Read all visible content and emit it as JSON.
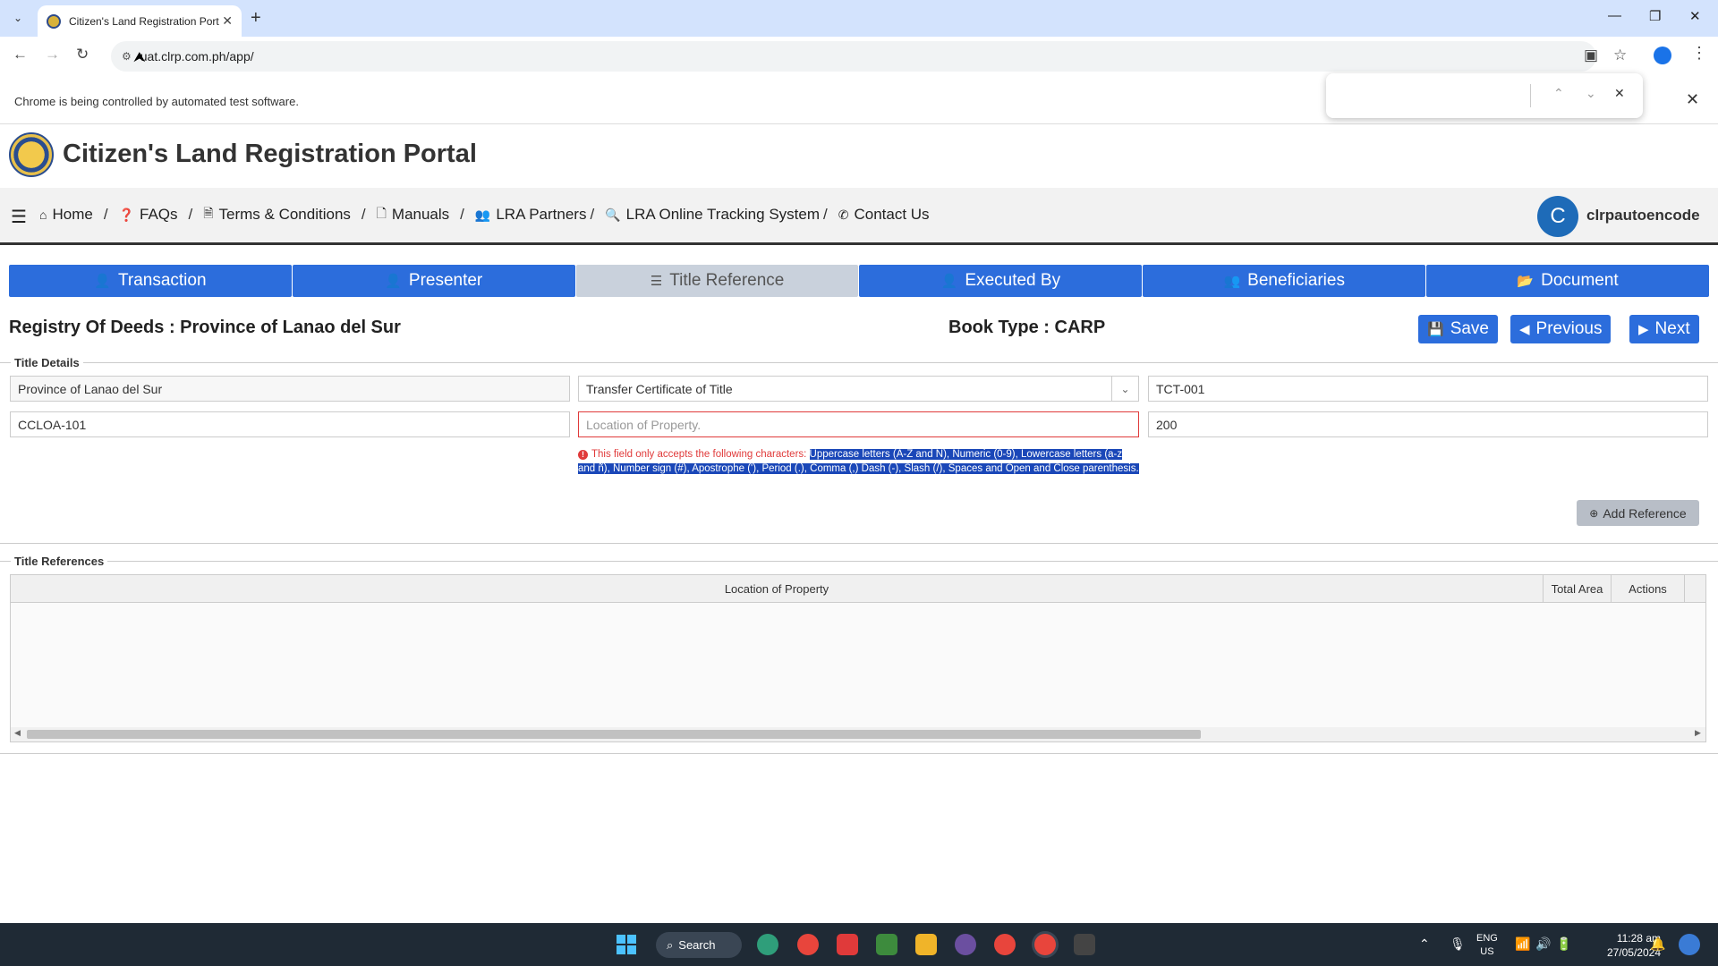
{
  "browser": {
    "tab_title": "Citizen's Land Registration Port",
    "url": "uat.clrp.com.ph/app/",
    "infobar_text": "Chrome is being controlled by automated test software."
  },
  "site": {
    "title": "Citizen's Land Registration Portal",
    "nav": [
      {
        "label": "Home",
        "icon": "home-icon"
      },
      {
        "label": "FAQs",
        "icon": "question-circle-icon"
      },
      {
        "label": "Terms & Conditions",
        "icon": "document-icon"
      },
      {
        "label": "Manuals",
        "icon": "pdf-file-icon"
      },
      {
        "label": "LRA Partners",
        "icon": "users-icon"
      },
      {
        "label": "LRA Online Tracking System",
        "icon": "search-icon"
      },
      {
        "label": "Contact Us",
        "icon": "phone-icon"
      }
    ],
    "nav_separators": [
      "/",
      "/",
      "/",
      "/",
      "/",
      "/"
    ],
    "user": {
      "initial": "C",
      "name": "clrpautoencode"
    }
  },
  "steps": [
    {
      "label": "Transaction",
      "icon": "user-icon",
      "active": false
    },
    {
      "label": "Presenter",
      "icon": "user-icon",
      "active": false
    },
    {
      "label": "Title Reference",
      "icon": "list-icon",
      "active": true
    },
    {
      "label": "Executed By",
      "icon": "user-icon",
      "active": false
    },
    {
      "label": "Beneficiaries",
      "icon": "users-icon",
      "active": false
    },
    {
      "label": "Document",
      "icon": "folder-open-icon",
      "active": false
    }
  ],
  "header": {
    "registry_label": "Registry Of Deeds :",
    "registry_value": "Province of Lanao del Sur",
    "booktype_label": "Book Type :",
    "booktype_value": "CARP",
    "save_label": "Save",
    "previous_label": "Previous",
    "next_label": "Next"
  },
  "title_details": {
    "legend": "Title Details",
    "registry_field": "Province of Lanao del Sur",
    "title_type_selected": "Transfer Certificate of Title",
    "title_number": "TCT-001",
    "survey_number": "CCLOA-101",
    "location_placeholder": "Location of Property.",
    "area": "200",
    "error_prefix": "This field only accepts the following characters:",
    "error_highlighted": "Uppercase letters (A-Z and Ñ), Numeric (0-9), Lowercase letters (a-z and ñ), Number sign (#), Apostrophe ('), Period (.), Comma (,) Dash (-), Slash (/), Spaces and Open and Close parenthesis.",
    "add_reference_label": "Add Reference"
  },
  "title_references": {
    "legend": "Title References",
    "columns": [
      "Location of Property",
      "Total Area",
      "Actions"
    ]
  },
  "taskbar": {
    "search_label": "Search",
    "lang_top": "ENG",
    "lang_bottom": "US",
    "time": "11:28 am",
    "date": "27/05/2024"
  },
  "colors": {
    "primary": "#2c6ddc",
    "active_step": "#c9d1dc",
    "error": "#e03a3a",
    "selection": "#1a47b8"
  }
}
